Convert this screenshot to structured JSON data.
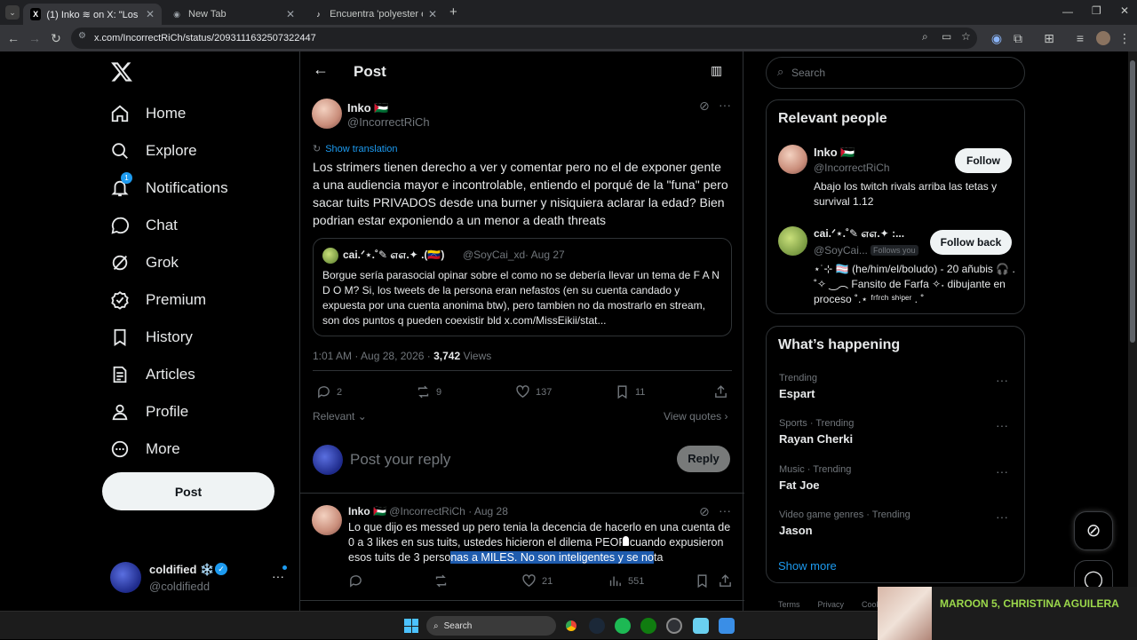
{
  "browser": {
    "tabs": [
      {
        "label": "(1) Inko ≋ on X: \"Los strimers t...",
        "icon": "X"
      },
      {
        "label": "New Tab",
        "icon": "◉"
      },
      {
        "label": "Encuentra 'polyester edit' en Ti...",
        "icon": "♪"
      }
    ],
    "url": "x.com/IncorrectRiCh/status/2093111632507322447"
  },
  "nav": {
    "items": [
      "Home",
      "Explore",
      "Notifications",
      "Chat",
      "Grok",
      "Premium",
      "History",
      "Articles",
      "Profile",
      "More"
    ],
    "notification_badge": "1",
    "post_label": "Post",
    "account": {
      "name": "coldified ❄️",
      "handle": "@coldifiedd"
    }
  },
  "main": {
    "header_title": "Post",
    "author": {
      "name": "Inko 🇵🇸",
      "handle": "@IncorrectRiCh"
    },
    "show_translation": "Show translation",
    "text": "Los strimers tienen derecho a ver y comentar pero no el de exponer gente a una audiencia mayor e incontrolable, entiendo el porqué de la \"funa\" pero sacar tuits PRIVADOS desde una burner y nisiquiera  aclarar la edad? Bien podrian estar exponiendo a un menor a death threats",
    "quote": {
      "name": "cai.ᐟ⋆.˚✎ ௭௭.✦ .(🇻🇪)",
      "handle": "@SoyCai_xd",
      "date": "· Aug 27",
      "text": "Borgue sería parasocial opinar sobre el como no se debería llevar un tema de F A N D O M? Si, los tweets de la persona eran nefastos (en su cuenta candado y expuesta por una cuenta anonima btw), pero tambien no da mostrarlo en stream, son dos puntos q pueden coexistir bld x.com/MissEikii/stat..."
    },
    "meta_time": "1:01 AM · Aug 28, 2026 · ",
    "meta_views_count": "3,742",
    "meta_views_label": " Views",
    "stats": {
      "replies": "2",
      "reposts": "9",
      "likes": "137",
      "bookmarks": "11"
    },
    "relevant_label": "Relevant",
    "view_quotes": "View quotes",
    "reply_placeholder": "Post your reply",
    "reply_button": "Reply",
    "reply_post": {
      "name": "Inko 🇵🇸",
      "handle": "@IncorrectRiCh",
      "date": "· Aug 28",
      "text_plain": "Lo que dijo es messed up pero tenia la decencia de hacerlo  en una cuenta de 0 a 3 likes en sus tuits, ustedes hicieron el dilema PEOR cuando  expusieron esos tuits de 3 perso",
      "text_selected": "nas a MILES. No son inteligentes  y se no",
      "text_end": "ta",
      "likes": "21",
      "views": "551"
    }
  },
  "right": {
    "search_placeholder": "Search",
    "relevant_title": "Relevant people",
    "people": [
      {
        "name": "Inko 🇵🇸",
        "handle": "@IncorrectRiCh",
        "button": "Follow",
        "bio": "Abajo los twitch rivals arriba las tetas y survival 1.12",
        "follows_you": ""
      },
      {
        "name": "cai.ᐟ⋆.˚✎ ௭௭.✦ :...",
        "handle": "@SoyCai...",
        "button": "Follow back",
        "bio": "⋆˙⊹ 🏳️‍⚧️ (he/him/el/boludo) - 20 añubis 🎧 . ˚✧ ‿︵ Fansito de Farfa ✧˖ dibujante en proceso ˚.⋆ ᶠʳᶠʳᶜʰ ˢʰⁱᵖᵉʳ . ˚",
        "follows_you": "Follows you"
      }
    ],
    "happening_title": "What’s happening",
    "trends": [
      {
        "category": "Trending",
        "name": "Espart"
      },
      {
        "category": "Sports · Trending",
        "name": "Rayan Cherki"
      },
      {
        "category": "Music · Trending",
        "name": "Fat Joe"
      },
      {
        "category": "Video game genres · Trending",
        "name": "Jason"
      }
    ],
    "show_more": "Show more",
    "footer": [
      "Terms",
      "Privacy",
      "Cook"
    ]
  },
  "taskbar": {
    "search_label": "Search",
    "media_title": "MAROON 5, CHRISTINA AGUILERA"
  },
  "colors": {
    "accent": "#1d9bf0",
    "background": "#000000",
    "border": "#2f3336",
    "muted": "#71767b"
  }
}
